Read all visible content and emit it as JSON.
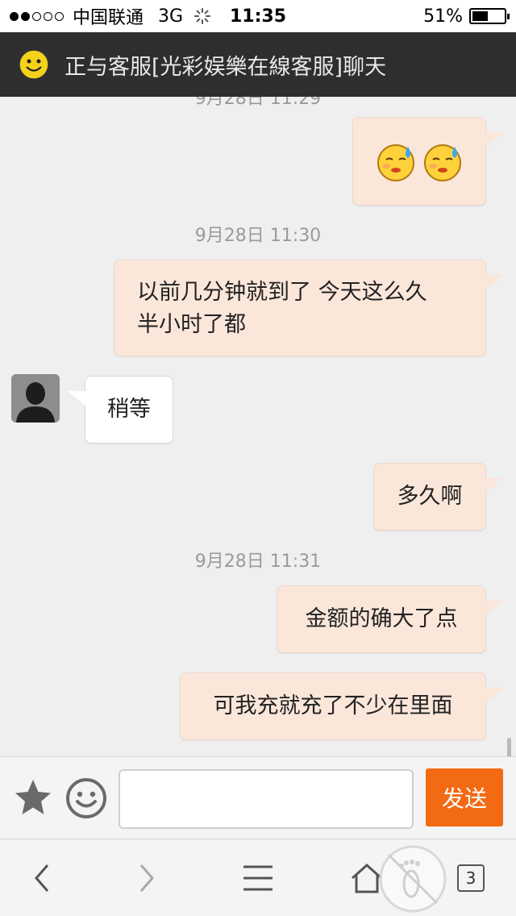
{
  "status_bar": {
    "carrier": "中国联通",
    "network": "3G",
    "time": "11:35",
    "battery": "51%",
    "battery_level": 0.51,
    "signal_bars_filled": 2,
    "signal_bars_total": 5
  },
  "header": {
    "title": "正与客服[光彩娱樂在線客服]聊天",
    "avatar_icon": "smiley-face-icon"
  },
  "messages": [
    {
      "type": "emoji",
      "from": "me",
      "emoji_icons": [
        "sweating-smiley-icon",
        "sweating-smiley-icon"
      ]
    },
    {
      "type": "timestamp",
      "text": "9月28日 11:30"
    },
    {
      "type": "text",
      "from": "me",
      "lines": [
        "以前几分钟就到了 今天这么久",
        "半小时了都"
      ]
    },
    {
      "type": "text",
      "from": "agent",
      "text": "稍等"
    },
    {
      "type": "text",
      "from": "me",
      "text": "多久啊"
    },
    {
      "type": "timestamp",
      "text": "9月28日 11:31"
    },
    {
      "type": "text",
      "from": "me",
      "text": "金额的确大了点"
    },
    {
      "type": "text",
      "from": "me",
      "text": "可我充就充了不少在里面"
    }
  ],
  "input_bar": {
    "star_icon": "star-icon",
    "emoji_icon": "smiley-icon",
    "input_value": "",
    "input_placeholder": "",
    "send_label": "发送"
  },
  "browser_toolbar": {
    "back_icon": "back-arrow-icon",
    "forward_icon": "forward-arrow-icon",
    "menu_icon": "menu-icon",
    "home_icon": "home-icon",
    "tab_count": "3",
    "overlay_icon": "footprint-icon"
  },
  "colors": {
    "header_bg": "#2e2e2e",
    "outgoing_bubble": "#fbe6da",
    "incoming_bubble": "#ffffff",
    "send_button": "#f26a14",
    "timestamp_text": "#9a9a9a"
  }
}
